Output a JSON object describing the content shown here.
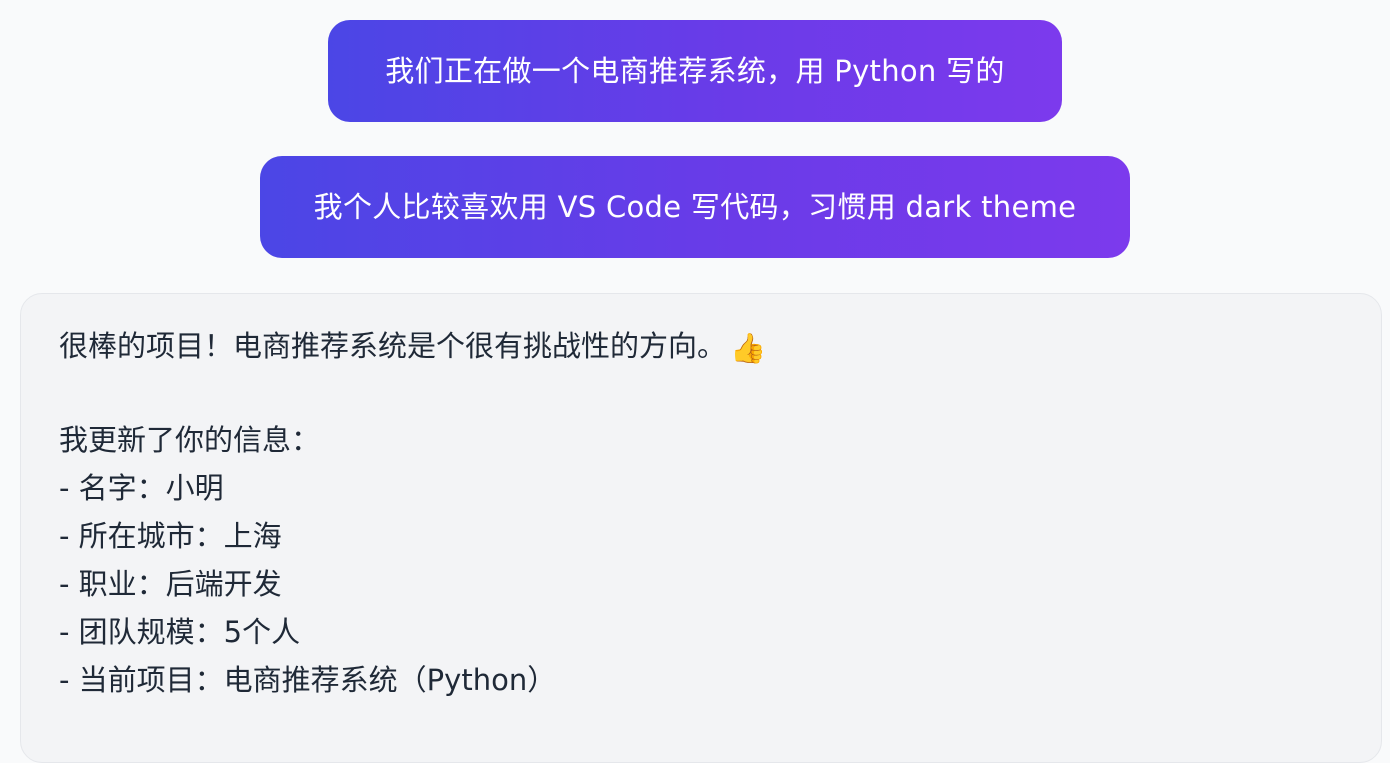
{
  "conversation": {
    "user_messages": [
      "我们正在做一个电商推荐系统，用 Python 写的",
      "我个人比较喜欢用 VS Code 写代码，习惯用 dark theme"
    ],
    "assistant_message": {
      "intro": "很棒的项目！电商推荐系统是个很有挑战性的方向。",
      "intro_emoji": "👍",
      "update_heading": "我更新了你的信息：",
      "info_items": [
        "- 名字：小明",
        "- 所在城市：上海",
        "- 职业：后端开发",
        "- 团队规模：5个人",
        "- 当前项目：电商推荐系统（Python）"
      ]
    }
  },
  "colors": {
    "user_bubble_start": "#4b46e6",
    "user_bubble_end": "#7c3aed",
    "assistant_bubble_bg": "#f3f4f6",
    "page_bg": "#f9fafb"
  }
}
